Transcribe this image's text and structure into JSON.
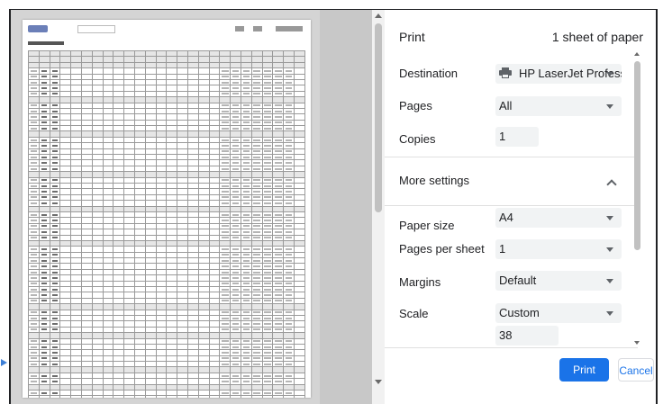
{
  "print_panel": {
    "title": "Print",
    "sheet_count": "1 sheet of paper",
    "destination": {
      "label": "Destination",
      "value": "HP LaserJet Professic"
    },
    "pages": {
      "label": "Pages",
      "value": "All"
    },
    "copies": {
      "label": "Copies",
      "value": "1"
    },
    "more_settings": {
      "label": "More settings"
    },
    "paper_size": {
      "label": "Paper size",
      "value": "A4"
    },
    "pages_per_sheet": {
      "label": "Pages per sheet",
      "value": "1"
    },
    "margins": {
      "label": "Margins",
      "value": "Default"
    },
    "scale": {
      "label": "Scale",
      "value": "Custom",
      "custom_value": "38"
    }
  },
  "footer": {
    "print_label": "Print",
    "cancel_label": "Cancel"
  },
  "icons": {
    "printer": "printer-icon",
    "caret": "chevron-down-icon",
    "collapse": "chevron-up-icon"
  },
  "colors": {
    "accent": "#1a73e8",
    "preview_bg": "#d4d4d4",
    "field_bg": "#f1f3f4"
  }
}
